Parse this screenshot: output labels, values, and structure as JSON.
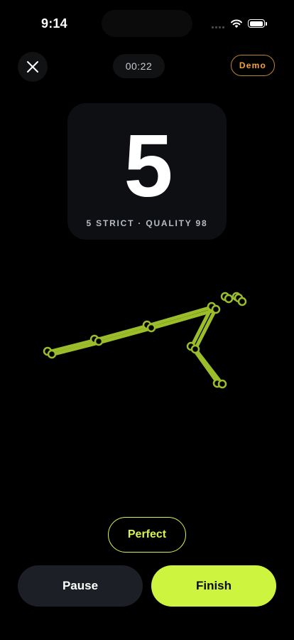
{
  "status_bar": {
    "time": "9:14",
    "battery_level": 1.0
  },
  "header": {
    "close_icon": "close-icon",
    "timer": "00:22",
    "mode_badge": "Demo",
    "accent_orange": "#f5a524"
  },
  "rep_card": {
    "count": "5",
    "subtitle": "5 STRICT · QUALITY 98"
  },
  "pose_overlay": {
    "color": "#9bbd2a",
    "description_icon": "skeleton-pose"
  },
  "feedback": {
    "label": "Perfect",
    "color": "#d7f54a"
  },
  "actions": {
    "pause_label": "Pause",
    "finish_label": "Finish",
    "finish_color": "#cdf53f"
  }
}
